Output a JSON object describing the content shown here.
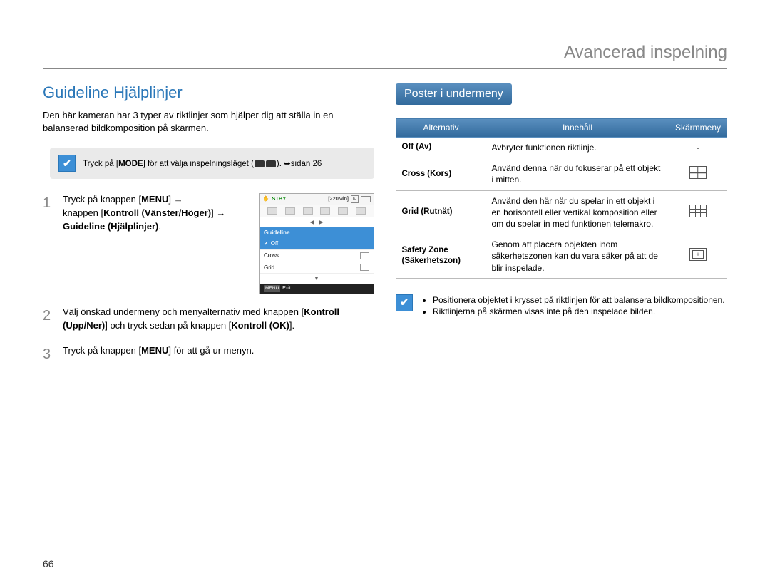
{
  "header": "Avancerad inspelning",
  "page_number": "66",
  "left": {
    "title": "Guideline Hjälplinjer",
    "intro": "Den här kameran har 3 typer av riktlinjer som hjälper dig att ställa in en balanserad bildkomposition på skärmen.",
    "note_prefix": "Tryck på [",
    "note_mode": "MODE",
    "note_mid": "] för att välja inspelningsläget (",
    "note_suffix": "). ",
    "note_page": "sidan 26",
    "step1_a": "Tryck på knappen [",
    "step1_menu": "MENU",
    "step1_b": "] ",
    "step1_c": "knappen [",
    "step1_ctrl1": "Kontroll (Vänster/Höger)",
    "step1_d": "] ",
    "step1_target": "Guideline (Hjälplinjer)",
    "step1_e": ".",
    "step2_a": "Välj önskad undermeny och menyalternativ med knappen [",
    "step2_ctrl": "Kontroll (Upp/Ner)",
    "step2_b": "] och tryck sedan på knappen [",
    "step2_ok": "Kontroll (OK)",
    "step2_c": "].",
    "step3_a": "Tryck på knappen [",
    "step3_menu": "MENU",
    "step3_b": "] för att gå ur menyn."
  },
  "screen": {
    "stby": "STBY",
    "time": "[220Min]",
    "menu_title": "Guideline",
    "opt_off": "Off",
    "opt_cross": "Cross",
    "opt_grid": "Grid",
    "exit_label": "Exit",
    "menu_badge": "MENU"
  },
  "right": {
    "submenu_header": "Poster i undermeny",
    "th_alt": "Alternativ",
    "th_cont": "Innehåll",
    "th_disp": "Skärmmeny",
    "rows": [
      {
        "alt": "Off (Av)",
        "cont": "Avbryter funktionen riktlinje.",
        "dash": "-"
      },
      {
        "alt": "Cross (Kors)",
        "cont": "Använd denna när du fokuserar på ett objekt i mitten."
      },
      {
        "alt": "Grid (Rutnät)",
        "cont": "Använd den här när du spelar in ett objekt i en horisontell eller vertikal komposition eller om du spelar in med funktionen telemakro."
      },
      {
        "alt": "Safety Zone (Säkerhetszon)",
        "cont": "Genom att placera objekten inom säkerhetszonen kan du vara säker på att de blir inspelade."
      }
    ],
    "tips": [
      "Positionera objektet i krysset på riktlinjen för att balansera bildkompositionen.",
      "Riktlinjerna på skärmen visas inte på den inspelade bilden."
    ]
  }
}
